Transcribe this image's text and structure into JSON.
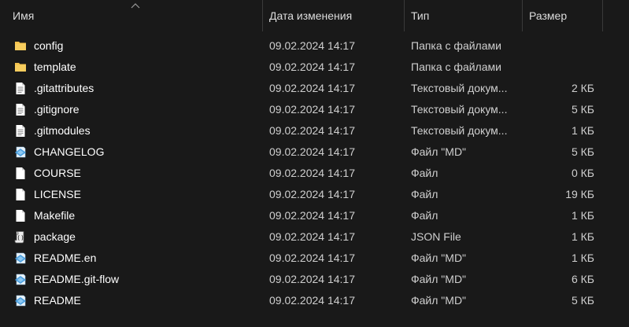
{
  "columns": {
    "name": "Имя",
    "date": "Дата изменения",
    "type": "Тип",
    "size": "Размер"
  },
  "colors": {
    "background": "#191919",
    "folder": "#f3c14b",
    "header_separator": "#3a3a3a"
  },
  "files": [
    {
      "name": "config",
      "date": "09.02.2024 14:17",
      "type": "Папка с файлами",
      "size": "",
      "icon": "folder-icon"
    },
    {
      "name": "template",
      "date": "09.02.2024 14:17",
      "type": "Папка с файлами",
      "size": "",
      "icon": "folder-icon"
    },
    {
      "name": ".gitattributes",
      "date": "09.02.2024 14:17",
      "type": "Текстовый докум...",
      "size": "2 КБ",
      "icon": "text-file-icon"
    },
    {
      "name": ".gitignore",
      "date": "09.02.2024 14:17",
      "type": "Текстовый докум...",
      "size": "5 КБ",
      "icon": "text-file-icon"
    },
    {
      "name": ".gitmodules",
      "date": "09.02.2024 14:17",
      "type": "Текстовый докум...",
      "size": "1 КБ",
      "icon": "text-file-icon"
    },
    {
      "name": "CHANGELOG",
      "date": "09.02.2024 14:17",
      "type": "Файл \"MD\"",
      "size": "5 КБ",
      "icon": "markdown-file-icon"
    },
    {
      "name": "COURSE",
      "date": "09.02.2024 14:17",
      "type": "Файл",
      "size": "0 КБ",
      "icon": "blank-file-icon"
    },
    {
      "name": "LICENSE",
      "date": "09.02.2024 14:17",
      "type": "Файл",
      "size": "19 КБ",
      "icon": "blank-file-icon"
    },
    {
      "name": "Makefile",
      "date": "09.02.2024 14:17",
      "type": "Файл",
      "size": "1 КБ",
      "icon": "blank-file-icon"
    },
    {
      "name": "package",
      "date": "09.02.2024 14:17",
      "type": "JSON File",
      "size": "1 КБ",
      "icon": "json-file-icon"
    },
    {
      "name": "README.en",
      "date": "09.02.2024 14:17",
      "type": "Файл \"MD\"",
      "size": "1 КБ",
      "icon": "markdown-file-icon"
    },
    {
      "name": "README.git-flow",
      "date": "09.02.2024 14:17",
      "type": "Файл \"MD\"",
      "size": "6 КБ",
      "icon": "markdown-file-icon"
    },
    {
      "name": "README",
      "date": "09.02.2024 14:17",
      "type": "Файл \"MD\"",
      "size": "5 КБ",
      "icon": "markdown-file-icon"
    }
  ]
}
